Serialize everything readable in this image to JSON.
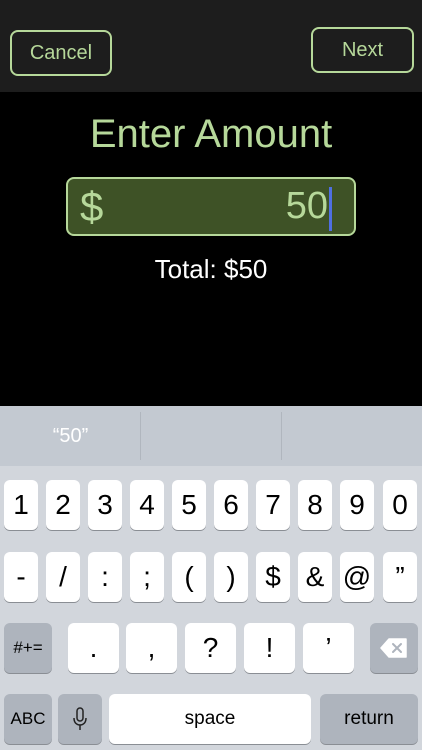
{
  "nav": {
    "cancel_label": "Cancel",
    "next_label": "Next"
  },
  "title": "Enter Amount",
  "amount": {
    "currency_symbol": "$",
    "value": "50"
  },
  "total_text": "Total: $50",
  "keyboard": {
    "suggestions": [
      "“50”",
      "",
      ""
    ],
    "row1": [
      "1",
      "2",
      "3",
      "4",
      "5",
      "6",
      "7",
      "8",
      "9",
      "0"
    ],
    "row2": [
      "-",
      "/",
      ":",
      ";",
      "(",
      ")",
      "$",
      "&",
      "@",
      "”"
    ],
    "row3": {
      "mode": "#+=",
      "keys": [
        ".",
        ",",
        "?",
        "!",
        "’"
      ],
      "delete_icon": "backspace-icon"
    },
    "row4": {
      "abc": "ABC",
      "mic_icon": "microphone-icon",
      "space": "space",
      "return": "return"
    }
  }
}
